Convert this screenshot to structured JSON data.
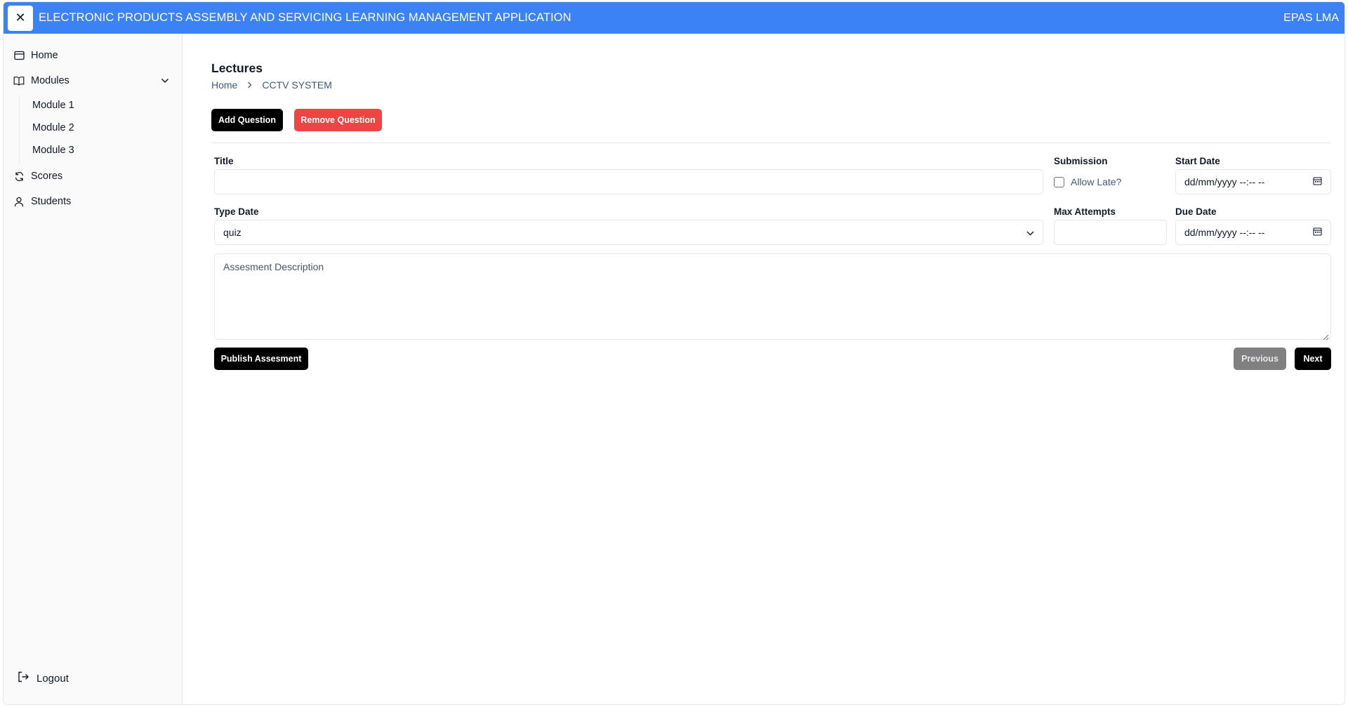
{
  "header": {
    "close_glyph": "✕",
    "title": "ELECTRONIC PRODUCTS ASSEMBLY AND SERVICING LEARNING MANAGEMENT APPLICATION",
    "short_name": "EPAS LMA",
    "color": "#3b82f6"
  },
  "sidebar": {
    "home": "Home",
    "modules": "Modules",
    "module_items": [
      "Module 1",
      "Module 2",
      "Module 3"
    ],
    "scores": "Scores",
    "students": "Students",
    "logout": "Logout"
  },
  "main": {
    "page_title": "Lectures",
    "breadcrumb": {
      "home": "Home",
      "current": "CCTV SYSTEM"
    },
    "buttons": {
      "add_question": "Add Question",
      "remove_question": "Remove Question",
      "publish": "Publish Assesment",
      "previous": "Previous",
      "next": "Next"
    },
    "form": {
      "title_label": "Title",
      "title_value": "",
      "submission_label": "Submission",
      "allow_late_label": "Allow Late?",
      "allow_late_checked": false,
      "start_date_label": "Start Date",
      "start_date_placeholder": "dd/mm/yyyy --:-- --",
      "type_label": "Type Date",
      "type_value": "quiz",
      "max_attempts_label": "Max Attempts",
      "max_attempts_value": "",
      "due_date_label": "Due Date",
      "due_date_placeholder": "dd/mm/yyyy --:-- --",
      "description_placeholder": "Assesment Description"
    }
  },
  "colors": {
    "accent": "#3b82f6",
    "danger": "#ef4444",
    "primary_button": "#000000",
    "disabled_button": "#808080"
  }
}
